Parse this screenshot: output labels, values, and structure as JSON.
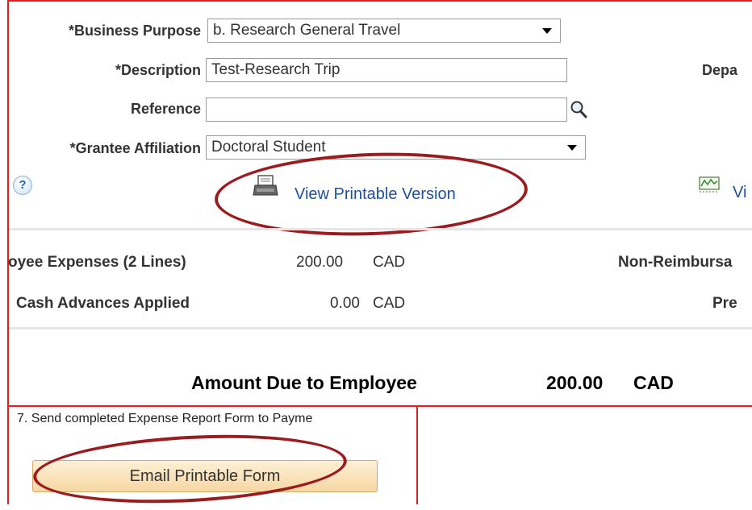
{
  "form": {
    "business_purpose": {
      "label": "*Business Purpose",
      "value": "b. Research General Travel"
    },
    "description": {
      "label": "*Description",
      "value": "Test-Research Trip"
    },
    "department_label_partial": "Depa",
    "reference": {
      "label": "Reference",
      "value": ""
    },
    "grantee_affiliation": {
      "label": "*Grantee Affiliation",
      "value": "Doctoral Student"
    },
    "help_icon": "?",
    "view_printable_version": "View Printable Version",
    "right_link_partial": "Vi"
  },
  "summary": {
    "employee_expenses_label": "oyee Expenses (2 Lines)",
    "employee_expenses_amount": "200.00",
    "employee_expenses_currency": "CAD",
    "non_reimbursable_label": "Non-Reimbursa",
    "cash_advances_label": "Cash Advances Applied",
    "cash_advances_amount": "0.00",
    "cash_advances_currency": "CAD",
    "prepaid_label": "Pre",
    "amount_due_label": "Amount Due to Employee",
    "amount_due_value": "200.00",
    "amount_due_currency": "CAD"
  },
  "step": {
    "text": "7. Send completed Expense Report Form to Payme",
    "email_button": "Email Printable Form"
  },
  "colors": {
    "frame_border": "#e02020",
    "highlight_oval": "#9b1b1e",
    "link": "#1e50a0",
    "button_top": "#fdf0d6",
    "button_bottom": "#f7d7a4"
  },
  "icons": [
    "search-icon",
    "help-icon",
    "printer-icon",
    "chart-icon",
    "dropdown-arrow-icon"
  ]
}
